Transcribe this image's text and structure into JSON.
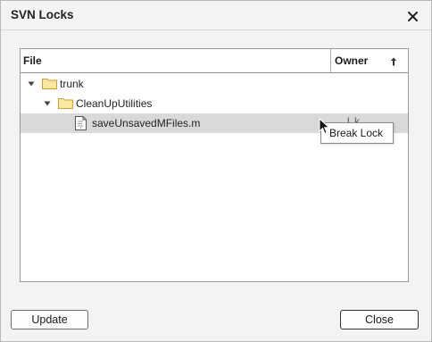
{
  "window": {
    "title": "SVN Locks"
  },
  "table": {
    "columns": {
      "file": "File",
      "owner": "Owner"
    },
    "rows": [
      {
        "label": "trunk",
        "type": "folder",
        "expanded": true
      },
      {
        "label": "CleanUpUtilities",
        "type": "folder",
        "expanded": true
      },
      {
        "label": "saveUnsavedMFiles.m",
        "type": "file",
        "owner_partial": "l k"
      }
    ]
  },
  "context_menu": {
    "items": [
      "Break Lock"
    ]
  },
  "buttons": {
    "update": "Update",
    "close": "Close"
  },
  "icons": {
    "close": "close-icon",
    "sort": "sort-ascending-icon",
    "folder": "folder-icon",
    "file": "file-icon",
    "caret": "chevron-down-icon"
  },
  "colors": {
    "selection": "#d9d9d9",
    "folder_fill": "#fbe7a1",
    "folder_stroke": "#c9a13b"
  }
}
